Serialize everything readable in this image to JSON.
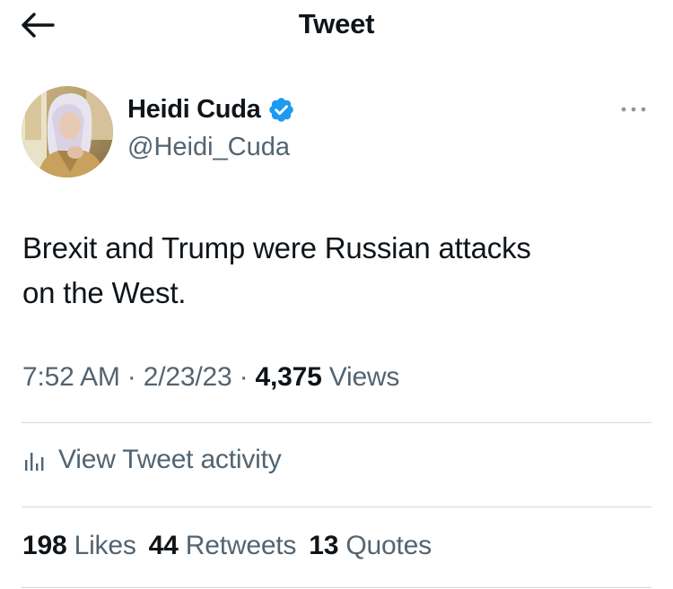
{
  "header": {
    "title": "Tweet",
    "back_icon": "arrow-left-icon"
  },
  "author": {
    "display_name": "Heidi Cuda",
    "handle": "@Heidi_Cuda",
    "verified_icon": "verified-badge-icon",
    "more_icon": "more-horizontal-icon"
  },
  "tweet": {
    "line1": "Brexit and Trump were Russian attacks",
    "line2": "on the West."
  },
  "meta": {
    "time": "7:52 AM",
    "sep1": " · ",
    "date": "2/23/23",
    "sep2": " · ",
    "views_count": "4,375",
    "views_label": "Views"
  },
  "activity": {
    "label": "View Tweet activity",
    "icon": "bar-chart-icon"
  },
  "stats": {
    "likes_count": "198",
    "likes_label": "Likes",
    "retweets_count": "44",
    "retweets_label": "Retweets",
    "quotes_count": "13",
    "quotes_label": "Quotes"
  },
  "colors": {
    "text": "#0f1419",
    "secondary": "#536471",
    "divider": "#cfd9de",
    "verified": "#1d9bf0"
  }
}
